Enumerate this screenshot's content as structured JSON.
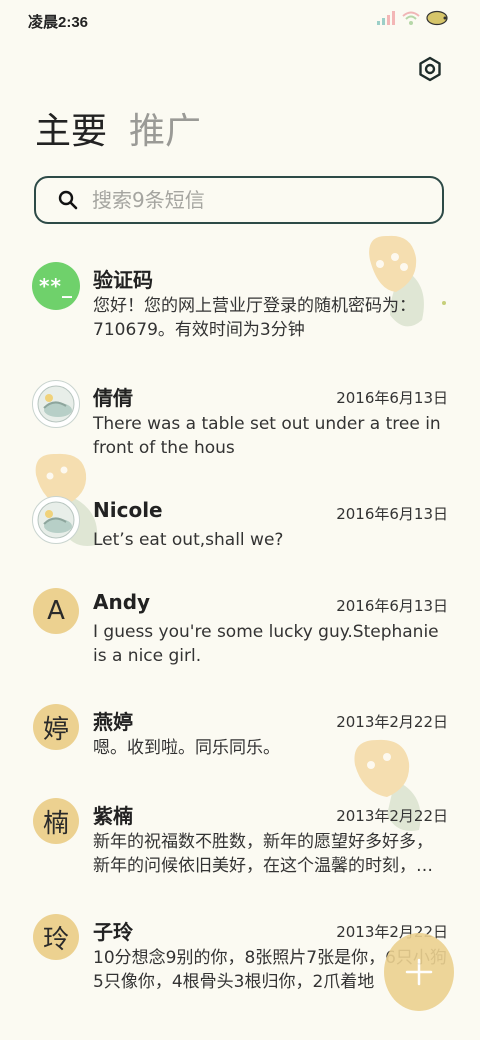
{
  "status_bar": {
    "time": "凌晨2:36",
    "icons": [
      "signal-icon",
      "wifi-icon",
      "battery-icon"
    ]
  },
  "header": {
    "settings_icon": "gear-icon",
    "tabs": [
      {
        "label": "主要",
        "active": true
      },
      {
        "label": "推广",
        "active": false
      }
    ]
  },
  "search": {
    "placeholder": "搜索9条短信",
    "value": ""
  },
  "messages": [
    {
      "avatar_type": "code",
      "avatar_text": "**_",
      "sender": "验证码",
      "date": "",
      "preview": "您好！您的网上营业厅登录的随机密码为：710679。有效时间为3分钟"
    },
    {
      "avatar_type": "photo",
      "avatar_text": "",
      "sender": "倩倩",
      "date": "2016年6月13日",
      "preview": "There was a table set out under a tree in front of the hous"
    },
    {
      "avatar_type": "photo",
      "avatar_text": "",
      "sender": "Nicole",
      "date": "2016年6月13日",
      "preview": "Let’s eat out,shall we?"
    },
    {
      "avatar_type": "letter",
      "avatar_text": "A",
      "sender": "Andy",
      "date": "2016年6月13日",
      "preview": "I guess you're some lucky guy.Stephanie is a nice girl."
    },
    {
      "avatar_type": "letter",
      "avatar_text": "婷",
      "sender": "燕婷",
      "date": "2013年2月22日",
      "preview": "嗯。收到啦。同乐同乐。"
    },
    {
      "avatar_type": "letter",
      "avatar_text": "楠",
      "sender": "紫楠",
      "date": "2013年2月22日",
      "preview": "新年的祝福数不胜数，新年的愿望好多好多，新年的问候依旧美好，在这个温馨的时刻，…"
    },
    {
      "avatar_type": "letter",
      "avatar_text": "玲",
      "sender": "子玲",
      "date": "2013年2月22日",
      "preview": "10分想念9别的你，8张照片7张是你，6只小狗5只像你，4根骨头3根归你，2爪着地"
    }
  ],
  "fab": {
    "icon": "plus-icon"
  },
  "colors": {
    "background": "#fbfaf2",
    "accent": "#ecd190",
    "search_border": "#2d4a47",
    "code_avatar": "#6fd16b"
  }
}
